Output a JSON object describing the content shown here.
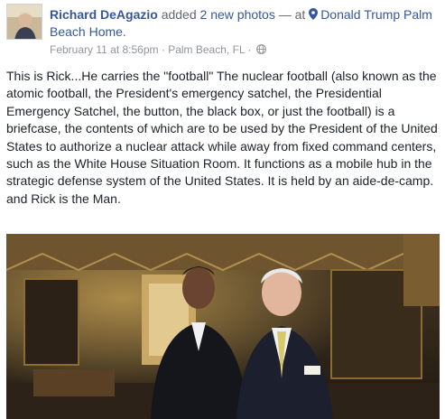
{
  "post": {
    "author": "Richard DeAgazio",
    "action": "added",
    "photos_link": "2 new photos",
    "separator": "— at",
    "place": "Donald Trump Palm Beach Home.",
    "timestamp": "February 11 at 8:56pm",
    "dot1": "·",
    "location": "Palm Beach, FL",
    "dot2": "·",
    "body_paragraph": "This is Rick...He carries the \"football\" The nuclear football (also known as the atomic football, the President's emergency satchel, the Presidential Emergency Satchel, the button, the black box, or just the football) is a briefcase, the contents of which are to be used by the President of the United States to authorize a nuclear attack while away from fixed command centers, such as the White House Situation Room. It functions as a mobile hub in the strategic defense system of the United States. It is held by an aide-de-camp.",
    "body_closing": "and Rick is the Man."
  },
  "icons": {
    "place": "location-pin-icon",
    "privacy": "globe-icon"
  },
  "colors": {
    "link": "#365899",
    "text": "#1d2129",
    "meta": "#90949c"
  }
}
